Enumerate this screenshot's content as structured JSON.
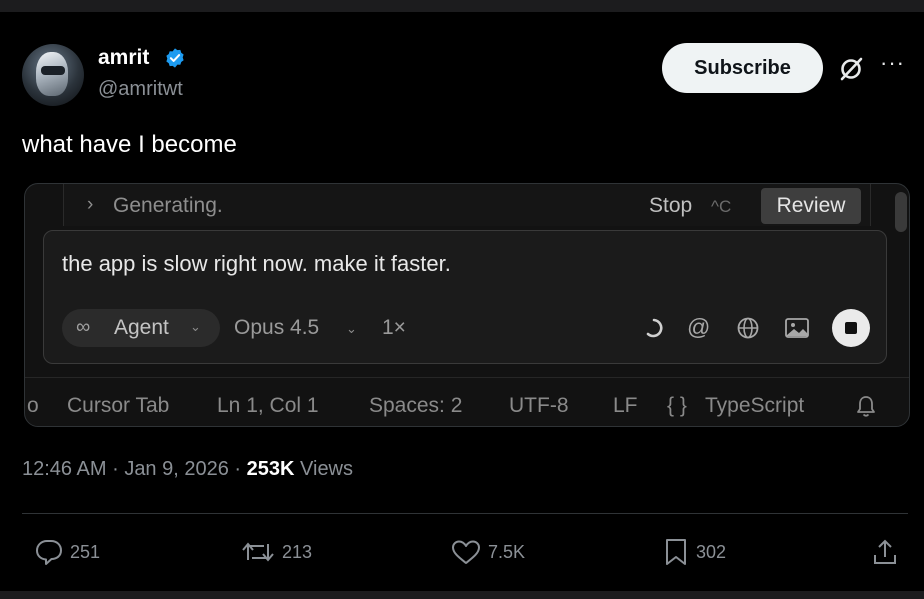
{
  "tweet": {
    "author_name": "amrit",
    "handle": "@amritwt",
    "subscribe_label": "Subscribe",
    "more_label": "···",
    "text": "what have I become",
    "time": "12:46 AM",
    "date": "Jan 9, 2026",
    "views_count": "253K",
    "views_label": "Views",
    "separator": "·"
  },
  "embed": {
    "generating_chevron": "›",
    "generating_text": "Generating.",
    "stop_label": "Stop",
    "stop_shortcut": "^C",
    "review_label": "Review",
    "prompt_text": "the app is slow right now. make it faster.",
    "agent_icon": "∞",
    "agent_label": "Agent",
    "model_label": "Opus 4.5",
    "dropdown_chevron": "⌄",
    "multiplier": "1×",
    "at_symbol": "@",
    "status_bar": {
      "cut_glyph": "o",
      "cursor_tab": "Cursor Tab",
      "position": "Ln 1, Col 1",
      "spaces": "Spaces: 2",
      "encoding": "UTF-8",
      "line_ending": "LF",
      "braces": "{ }",
      "language": "TypeScript"
    }
  },
  "actions": {
    "replies": "251",
    "reposts": "213",
    "likes": "7.5K",
    "bookmarks": "302"
  },
  "colors": {
    "background": "#000000",
    "verified": "#1d9bf0",
    "muted": "#8b9096"
  },
  "icons": [
    "verified-badge-icon",
    "grok-icon",
    "more-icon",
    "chevron-right-icon",
    "infinity-icon",
    "chevron-down-icon",
    "spinner-icon",
    "at-icon",
    "globe-icon",
    "image-icon",
    "stop-icon",
    "bell-icon",
    "reply-icon",
    "repost-icon",
    "like-icon",
    "bookmark-icon",
    "share-icon"
  ]
}
